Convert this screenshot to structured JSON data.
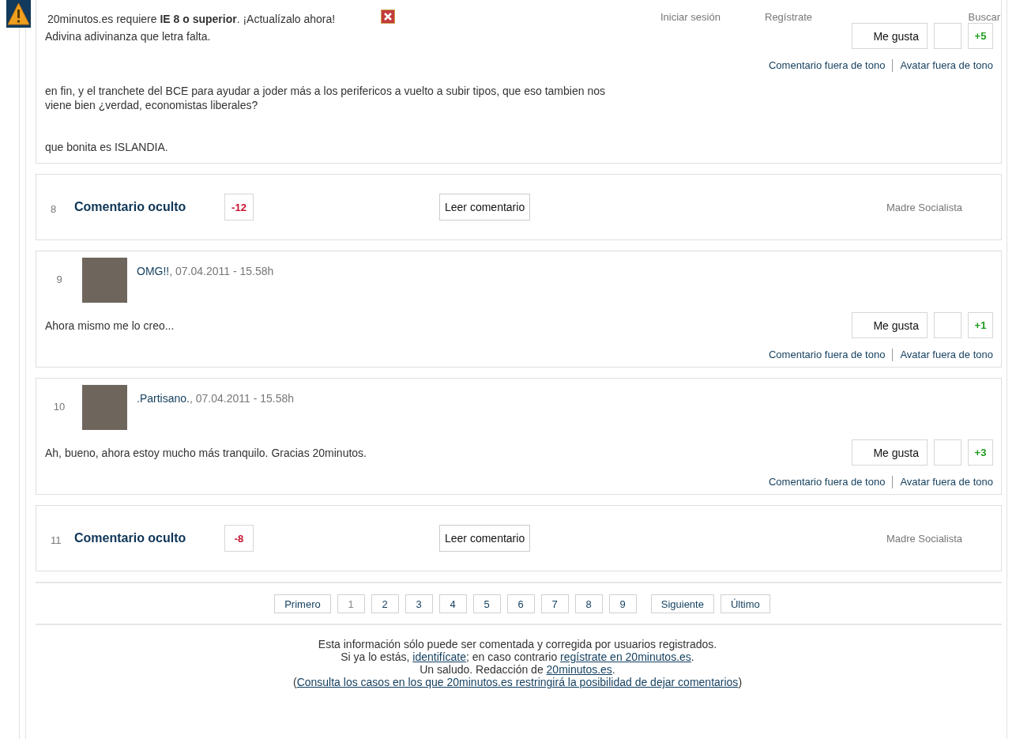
{
  "top_bar": {
    "message": "20minutos.es requiere **IE 8 o superior**. ¡Actualízalo ahora!",
    "links": [
      "Iniciar sesión",
      "Regístrate",
      "Buscar"
    ]
  },
  "comments": [
    {
      "kind": "visible",
      "body": [
        "Adivina adivinanza que letra falta.",
        "en fin, y el tranchete del BCE para ayudar a joder más a los perifericos a vuelto a subir tipos, que eso tambien nos viene bien ¿verdad, economistas liberales?",
        "que bonita es ISLANDIA."
      ],
      "like": "Me gusta",
      "score": "+5",
      "color": "#1e9c1e",
      "reports": [
        "Comentario fuera de tono",
        "Avatar fuera de tono"
      ]
    },
    {
      "kind": "hidden",
      "number": "8",
      "title": "Comentario oculto",
      "score": "-12",
      "color": "#c8102e",
      "button": "Leer comentario",
      "author": "Madre Socialista"
    },
    {
      "kind": "visible",
      "number": "9",
      "author": "OMG!!",
      "date": ", 07.04.2011 - 15.58h",
      "avatar": true,
      "body": [
        "Ahora mismo me lo creo..."
      ],
      "like": "Me gusta",
      "score": "+1",
      "color": "#1e9c1e",
      "reports": [
        "Comentario fuera de tono",
        "Avatar fuera de tono"
      ]
    },
    {
      "kind": "visible",
      "number": "10",
      "author": ".Partisano.",
      "date": ", 07.04.2011 - 15.58h",
      "avatar": true,
      "body": [
        "Ah, bueno, ahora estoy mucho más tranquilo. Gracias 20minutos."
      ],
      "like": "Me gusta",
      "score": "+3",
      "color": "#1e9c1e",
      "reports": [
        "Comentario fuera de tono",
        "Avatar fuera de tono"
      ]
    },
    {
      "kind": "hidden",
      "number": "11",
      "title": "Comentario oculto",
      "score": "-8",
      "color": "#c8102e",
      "button": "Leer comentario",
      "author": "Madre Socialista"
    }
  ],
  "pagination": [
    {
      "label": "Primero",
      "kind": "nav",
      "selected": false
    },
    {
      "label": "1",
      "kind": "page",
      "selected": true
    },
    {
      "label": "2",
      "kind": "page",
      "selected": false
    },
    {
      "label": "3",
      "kind": "page",
      "selected": false
    },
    {
      "label": "4",
      "kind": "page",
      "selected": false
    },
    {
      "label": "5",
      "kind": "page",
      "selected": false
    },
    {
      "label": "6",
      "kind": "page",
      "selected": false
    },
    {
      "label": "7",
      "kind": "page",
      "selected": false
    },
    {
      "label": "8",
      "kind": "page",
      "selected": false
    },
    {
      "label": "9",
      "kind": "page",
      "selected": false
    },
    {
      "label": "Siguiente",
      "kind": "nav",
      "selected": false
    },
    {
      "label": "Último",
      "kind": "nav",
      "selected": false
    }
  ],
  "footer": [
    [
      {
        "text": "Esta información sólo puede ser comentada y corregida por usuarios registrados."
      }
    ],
    [
      {
        "text": "Si ya lo estás, "
      },
      {
        "link": "identifícate"
      },
      {
        "text": "; en caso contrario "
      },
      {
        "link": "regístrate en 20minutos.es"
      },
      {
        "text": "."
      }
    ],
    [
      {
        "text": "Un saludo. Redacción de "
      },
      {
        "link": "20minutos.es"
      },
      {
        "text": "."
      }
    ],
    [
      {
        "text": "("
      },
      {
        "link": "Consulta los casos en los que 20minutos.es restringirá la posibilidad de dejar comentarios"
      },
      {
        "text": ")"
      }
    ]
  ]
}
